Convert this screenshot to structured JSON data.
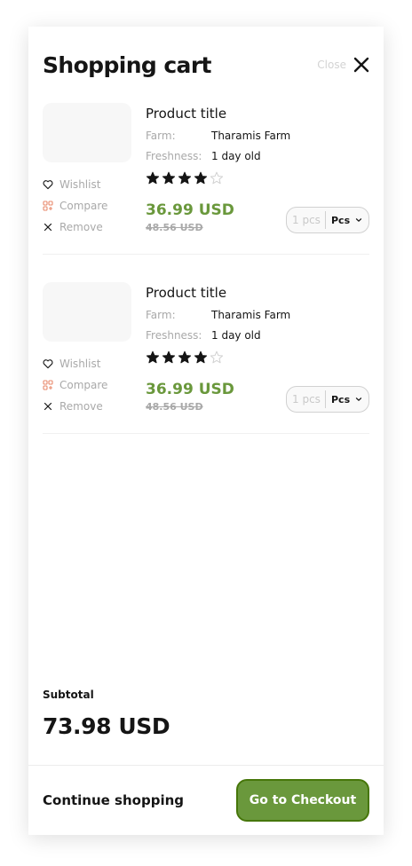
{
  "cart": {
    "title": "Shopping cart",
    "close_label": "Close"
  },
  "items": [
    {
      "title": "Product title",
      "farm_label": "Farm:",
      "farm_value": "Tharamis Farm",
      "freshness_label": "Freshness:",
      "freshness_value": "1 day old",
      "rating": 4,
      "rating_max": 5,
      "price": "36.99 USD",
      "old_price": "48.56 USD",
      "quantity": "1 pcs",
      "unit": "Pcs",
      "actions": {
        "wishlist": "Wishlist",
        "compare": "Compare",
        "remove": "Remove"
      }
    },
    {
      "title": "Product title",
      "farm_label": "Farm:",
      "farm_value": "Tharamis Farm",
      "freshness_label": "Freshness:",
      "freshness_value": "1 day old",
      "rating": 4,
      "rating_max": 5,
      "price": "36.99 USD",
      "old_price": "48.56 USD",
      "quantity": "1 pcs",
      "unit": "Pcs",
      "actions": {
        "wishlist": "Wishlist",
        "compare": "Compare",
        "remove": "Remove"
      }
    }
  ],
  "summary": {
    "subtotal_label": "Subtotal",
    "subtotal_value": "73.98 USD"
  },
  "footer": {
    "continue_label": "Continue shopping",
    "checkout_label": "Go to Checkout"
  },
  "colors": {
    "accent": "#6a983c",
    "accent_border": "#46760a",
    "muted_text": "#a9a9a9",
    "compare_icon": "#e8896b"
  },
  "icons": {
    "close": "close-icon",
    "wishlist": "heart-icon",
    "compare": "compare-icon",
    "remove": "remove-icon",
    "star": "star-icon",
    "chevron": "chevron-down-icon"
  }
}
